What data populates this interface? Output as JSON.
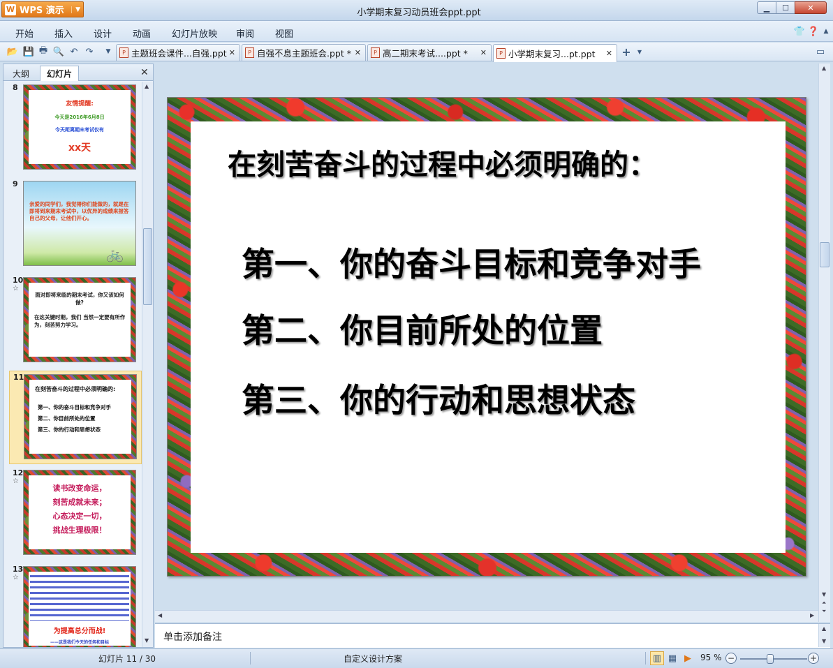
{
  "app": {
    "name": "WPS 演示",
    "window_title": "小学期末复习动员班会ppt.ppt"
  },
  "menu": [
    "开始",
    "插入",
    "设计",
    "动画",
    "幻灯片放映",
    "审阅",
    "视图"
  ],
  "tabs": [
    {
      "label": "主题班会课件...自强.ppt",
      "active": false
    },
    {
      "label": "自强不息主题班会.ppt *",
      "active": false
    },
    {
      "label": "高二期末考试....ppt *",
      "active": false
    },
    {
      "label": "小学期末复习...pt.ppt",
      "active": true
    }
  ],
  "panel": {
    "tabs": [
      "大纲",
      "幻灯片"
    ],
    "active_tab": "幻灯片"
  },
  "thumbnails": [
    {
      "num": "8",
      "star": "",
      "lines": [
        "友情提醒:",
        "今天是2016年6月8日",
        "今天距离期末考试仅有",
        "xx天"
      ]
    },
    {
      "num": "9",
      "star": "",
      "lines": [
        "亲爱的同学们，我觉得你们能做的，就是在即将到来期末考试中，以优异的成绩来报答自己的父母，让他们开心。"
      ]
    },
    {
      "num": "10",
      "star": "☆",
      "lines": [
        "面对即将来临的期末考试，你又该如何做?",
        "在这关键时期，我们 当然一定要有所作为，刻苦努力学习。"
      ]
    },
    {
      "num": "11",
      "star": "",
      "lines": [
        "在刻苦奋斗的过程中必须明确的:",
        "第一、你的奋斗目标和竞争对手",
        "第二、你目前所处的位置",
        "第三、你的行动和思想状态"
      ]
    },
    {
      "num": "12",
      "star": "☆",
      "lines": [
        "读书改变命运，",
        "刻苦成就未来；",
        "心态决定一切，",
        "挑战生理极限！"
      ]
    },
    {
      "num": "13",
      "star": "☆",
      "lines": [
        "为提高总分而战!",
        "——这是我们今天的任务和目标"
      ]
    }
  ],
  "slide": {
    "title": "在刻苦奋斗的过程中必须明确的：",
    "bullets": [
      "第一、你的奋斗目标和竞争对手",
      "第二、你目前所处的位置",
      "第三、你的行动和思想状态"
    ]
  },
  "notes_placeholder": "单击添加备注",
  "status": {
    "slide_position": "幻灯片 11 / 30",
    "theme": "自定义设计方案",
    "zoom": "95 %"
  },
  "icons": {
    "open": "open-folder-icon",
    "save": "save-icon",
    "print": "print-icon",
    "preview": "print-preview-icon",
    "undo": "undo-icon",
    "redo": "redo-icon"
  },
  "colors": {
    "accent_orange": "#e0781a",
    "selection": "#fbe9b2",
    "chrome_blue": "#cfdfee"
  }
}
